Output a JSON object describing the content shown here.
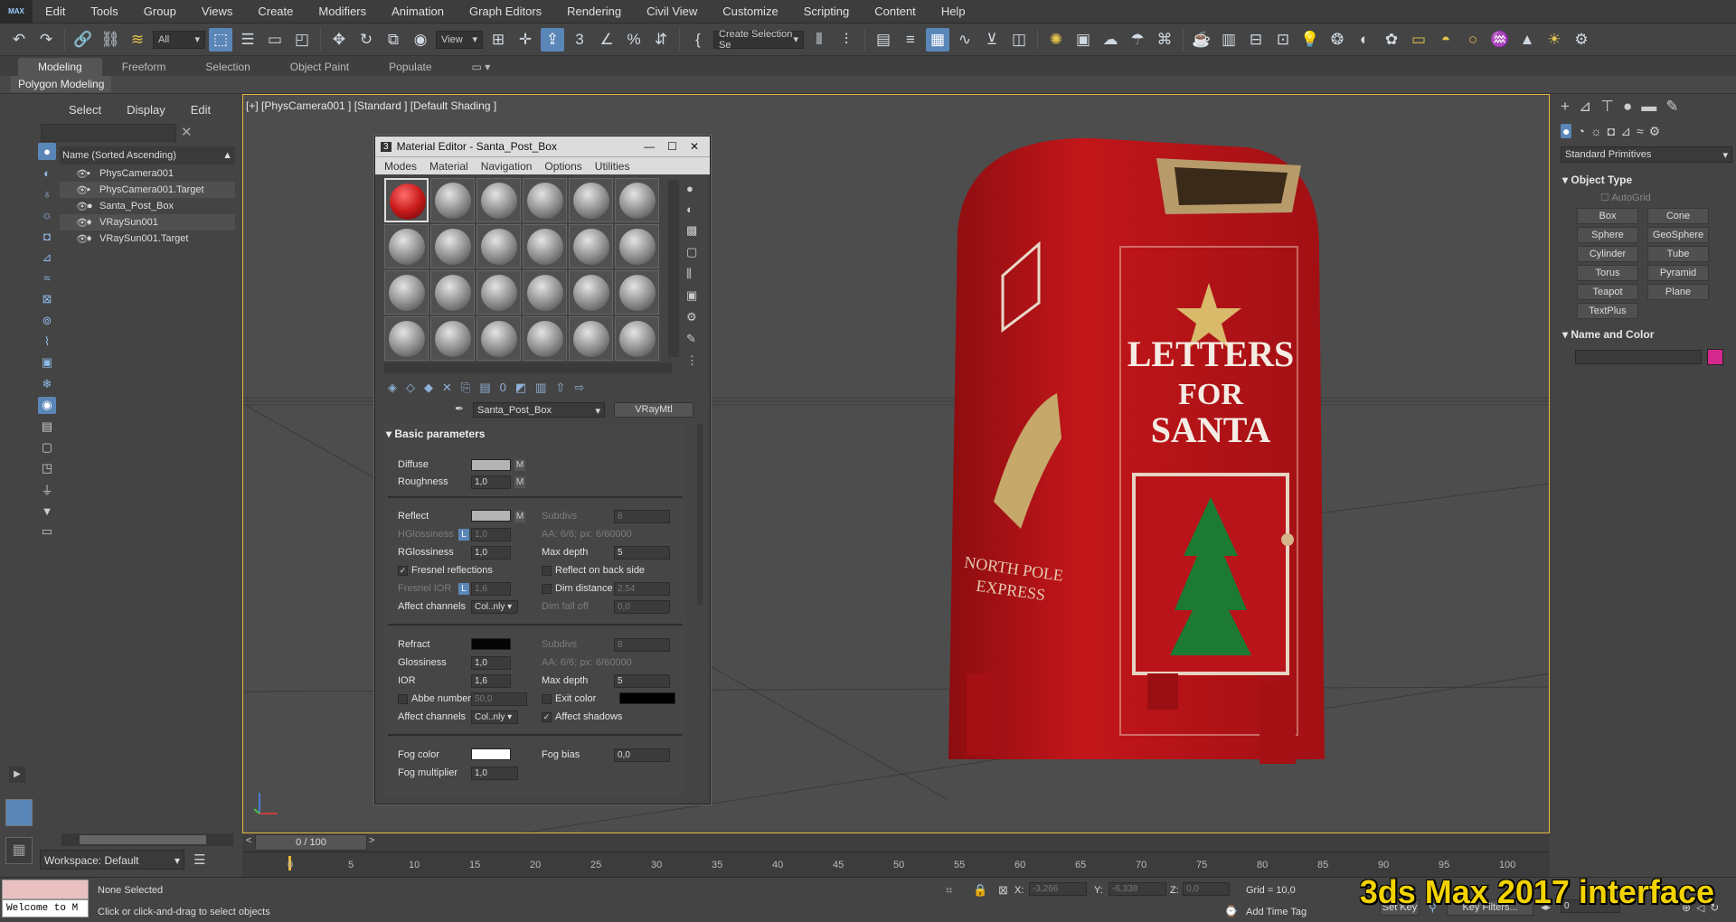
{
  "app": {
    "logo": "MAX"
  },
  "menu": [
    "Edit",
    "Tools",
    "Group",
    "Views",
    "Create",
    "Modifiers",
    "Animation",
    "Graph Editors",
    "Rendering",
    "Civil View",
    "Customize",
    "Scripting",
    "Content",
    "Help"
  ],
  "toolbar": {
    "filter": "All",
    "ref_coord": "View",
    "named_sel": "Create Selection Se",
    "snap_label": "3"
  },
  "ribbon": {
    "tabs": [
      "Modeling",
      "Freeform",
      "Selection",
      "Object Paint",
      "Populate"
    ],
    "active": "Modeling",
    "sub": "Polygon Modeling"
  },
  "scene_explorer": {
    "tabs": [
      "Select",
      "Display",
      "Edit"
    ],
    "header": "Name (Sorted Ascending)",
    "items": [
      {
        "name": "PhysCamera001",
        "icon": "camera-icon"
      },
      {
        "name": "PhysCamera001.Target",
        "icon": "camera-icon"
      },
      {
        "name": "Santa_Post_Box",
        "icon": "sphere-icon"
      },
      {
        "name": "VRaySun001",
        "icon": "light-icon"
      },
      {
        "name": "VRaySun001.Target",
        "icon": "light-icon"
      }
    ],
    "workspace": "Workspace: Default"
  },
  "viewport": {
    "label": "[+] [PhysCamera001 ] [Standard ] [Default Shading ]",
    "box_text": [
      "LETTERS",
      "FOR",
      "SANTA"
    ],
    "box_side_text": [
      "NORTH POLE",
      "EXPRESS"
    ]
  },
  "material_editor": {
    "title": "Material Editor - Santa_Post_Box",
    "menus": [
      "Modes",
      "Material",
      "Navigation",
      "Options",
      "Utilities"
    ],
    "material_name": "Santa_Post_Box",
    "material_type": "VRayMtl",
    "rollout": "Basic parameters",
    "diffuse": {
      "label": "Diffuse",
      "m": "M"
    },
    "roughness": {
      "label": "Roughness",
      "value": "1,0",
      "m": "M"
    },
    "reflect": {
      "label": "Reflect",
      "m": "M",
      "subdivs_label": "Subdivs",
      "subdivs": "8"
    },
    "hglossiness": {
      "label": "HGlossiness",
      "value": "1,0",
      "aa": "AA: 6/6; px: 6/60000"
    },
    "rglossiness": {
      "label": "RGlossiness",
      "value": "1,0",
      "maxdepth_label": "Max depth",
      "maxdepth": "5"
    },
    "fresnel": {
      "label": "Fresnel reflections",
      "checked": true,
      "backside": "Reflect on back side"
    },
    "fresnel_ior": {
      "label": "Fresnel IOR",
      "value": "1,6",
      "dimdist": "Dim distance",
      "dimdist_value": "2,54"
    },
    "affect1": {
      "label": "Affect channels",
      "value": "Col..nly",
      "falloff": "Dim fall off",
      "falloff_value": "0,0"
    },
    "refract": {
      "label": "Refract",
      "subdivs_label": "Subdivs",
      "subdivs": "8"
    },
    "glossiness": {
      "label": "Glossiness",
      "value": "1,0",
      "aa": "AA: 6/6; px: 6/60000"
    },
    "ior": {
      "label": "IOR",
      "value": "1,6",
      "maxdepth_label": "Max depth",
      "maxdepth": "5"
    },
    "abbe": {
      "label": "Abbe number",
      "value": "50,0",
      "exit": "Exit color"
    },
    "affect2": {
      "label": "Affect channels",
      "value": "Col..nly",
      "shadows": "Affect shadows"
    },
    "fog": {
      "label": "Fog color",
      "bias": "Fog bias",
      "bias_value": "0,0"
    },
    "fogmult": {
      "label": "Fog multiplier",
      "value": "1,0"
    },
    "colors": {
      "diffuse": "#b4b4b4",
      "reflect": "#b4b4b4",
      "refract": "#050505",
      "exit": "#000000",
      "fog": "#ffffff"
    }
  },
  "command_panel": {
    "dropdown": "Standard Primitives",
    "rollout1": "Object Type",
    "autogrid": "AutoGrid",
    "buttons": [
      "Box",
      "Cone",
      "Sphere",
      "GeoSphere",
      "Cylinder",
      "Tube",
      "Torus",
      "Pyramid",
      "Teapot",
      "Plane",
      "TextPlus"
    ],
    "rollout2": "Name and Color",
    "color": "#d4288c"
  },
  "timeline": {
    "frame": "0 / 100",
    "ticks": [
      "0",
      "5",
      "10",
      "15",
      "20",
      "25",
      "30",
      "35",
      "40",
      "45",
      "50",
      "55",
      "60",
      "65",
      "70",
      "75",
      "80",
      "85",
      "90",
      "95",
      "100"
    ]
  },
  "status": {
    "selection": "None Selected",
    "hint": "Click or click-and-drag to select objects",
    "script": "Welcome to M",
    "x_label": "X:",
    "x": "-3,266",
    "y_label": "Y:",
    "y": "-6,338",
    "z_label": "Z:",
    "z": "0,0",
    "grid": "Grid = 10,0",
    "add_time_tag": "Add Time Tag",
    "set_key": "Set Key",
    "key_filters": "Key Filters...",
    "frame_spin": "0"
  },
  "watermark": "3ds Max 2017 interface"
}
